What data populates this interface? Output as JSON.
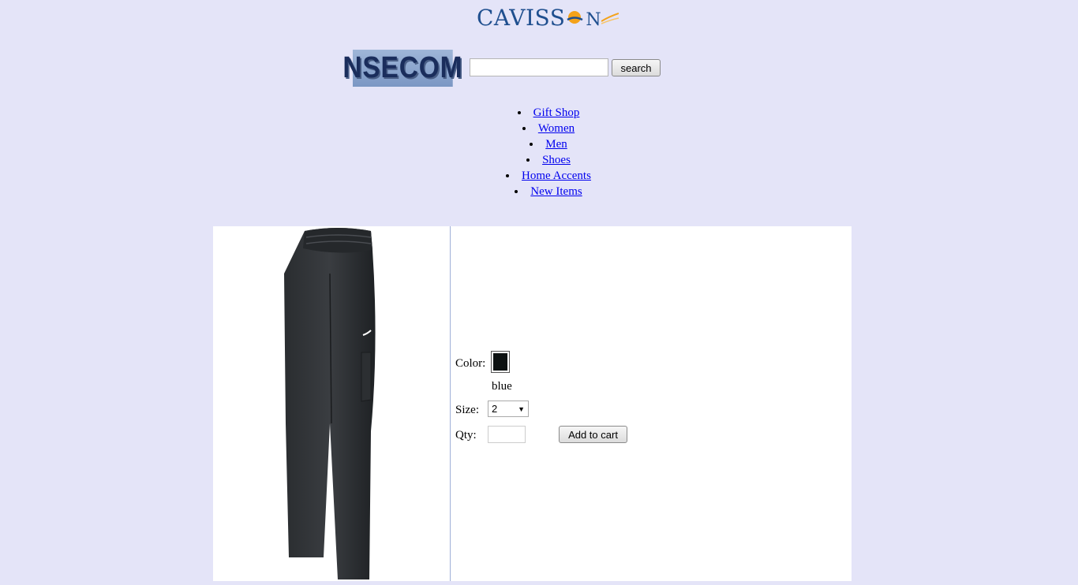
{
  "header": {
    "brand_text_lead": "CAVISS",
    "brand_text_tail": "N",
    "logo_text": "NSECOM",
    "search": {
      "value": "",
      "placeholder": ""
    },
    "search_label": "search"
  },
  "nav": {
    "items": [
      {
        "label": " Gift Shop "
      },
      {
        "label": " Women "
      },
      {
        "label": " Men "
      },
      {
        "label": " Shoes "
      },
      {
        "label": " Home Accents "
      },
      {
        "label": " New Items "
      }
    ]
  },
  "product": {
    "color_label": "Color:",
    "color_name": "blue",
    "swatch_color": "#0d1212",
    "size_label": "Size:",
    "size_value": "2",
    "qty_label": "Qty:",
    "qty_value": "",
    "add_to_cart_label": "Add to cart"
  }
}
